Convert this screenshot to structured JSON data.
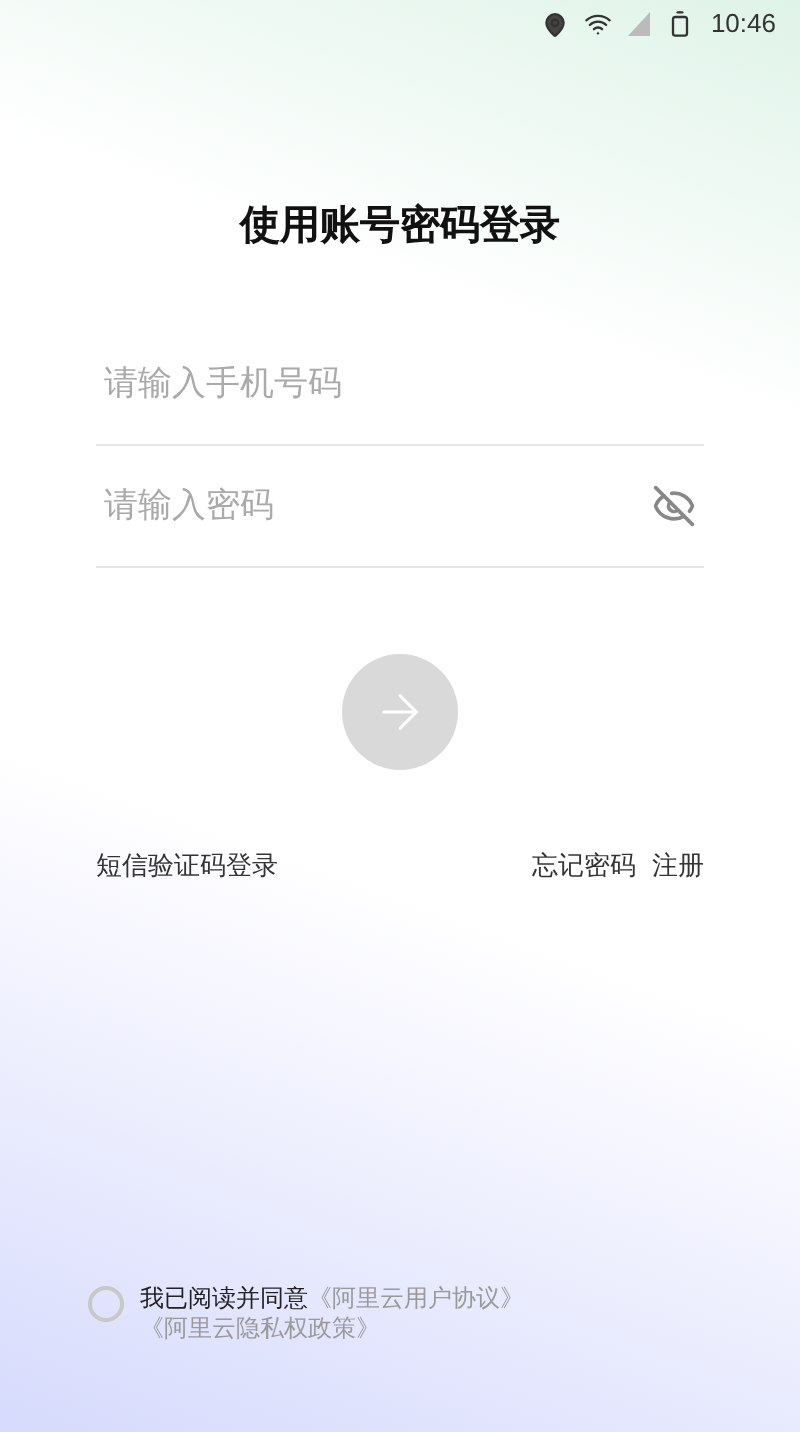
{
  "status_bar": {
    "time": "10:46"
  },
  "title": "使用账号密码登录",
  "fields": [
    {
      "kind": "phone",
      "placeholder": "请输入手机号码"
    },
    {
      "kind": "password",
      "placeholder": "请输入密码"
    }
  ],
  "submit": {
    "disabled": true
  },
  "links": {
    "sms_login": "短信验证码登录",
    "forgot": "忘记密码",
    "register": "注册"
  },
  "agreement": {
    "checked": false,
    "text": "我已阅读并同意",
    "docs": [
      "《阿里云用户协议》",
      "《阿里云隐私权政策》"
    ]
  }
}
